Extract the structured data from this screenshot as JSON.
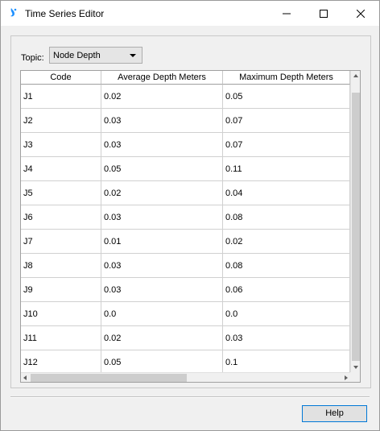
{
  "window": {
    "title": "Time Series Editor"
  },
  "colors": {
    "accent": "#0078d7",
    "icon_blue": "#1e90ff"
  },
  "topic": {
    "label": "Topic:",
    "value": "Node Depth"
  },
  "table": {
    "columns": [
      "Code",
      "Average Depth Meters",
      "Maximum Depth Meters"
    ],
    "rows": [
      [
        "J1",
        "0.02",
        "0.05"
      ],
      [
        "J2",
        "0.03",
        "0.07"
      ],
      [
        "J3",
        "0.03",
        "0.07"
      ],
      [
        "J4",
        "0.05",
        "0.11"
      ],
      [
        "J5",
        "0.02",
        "0.04"
      ],
      [
        "J6",
        "0.03",
        "0.08"
      ],
      [
        "J7",
        "0.01",
        "0.02"
      ],
      [
        "J8",
        "0.03",
        "0.08"
      ],
      [
        "J9",
        "0.03",
        "0.06"
      ],
      [
        "J10",
        "0.0",
        "0.0"
      ],
      [
        "J11",
        "0.02",
        "0.03"
      ],
      [
        "J12",
        "0.05",
        "0.1"
      ]
    ]
  },
  "buttons": {
    "help": "Help"
  },
  "icons": {
    "app": "water-drop-icon",
    "minimize": "minimize-icon",
    "maximize": "maximize-icon",
    "close": "close-icon",
    "dropdown": "chevron-down-icon"
  }
}
